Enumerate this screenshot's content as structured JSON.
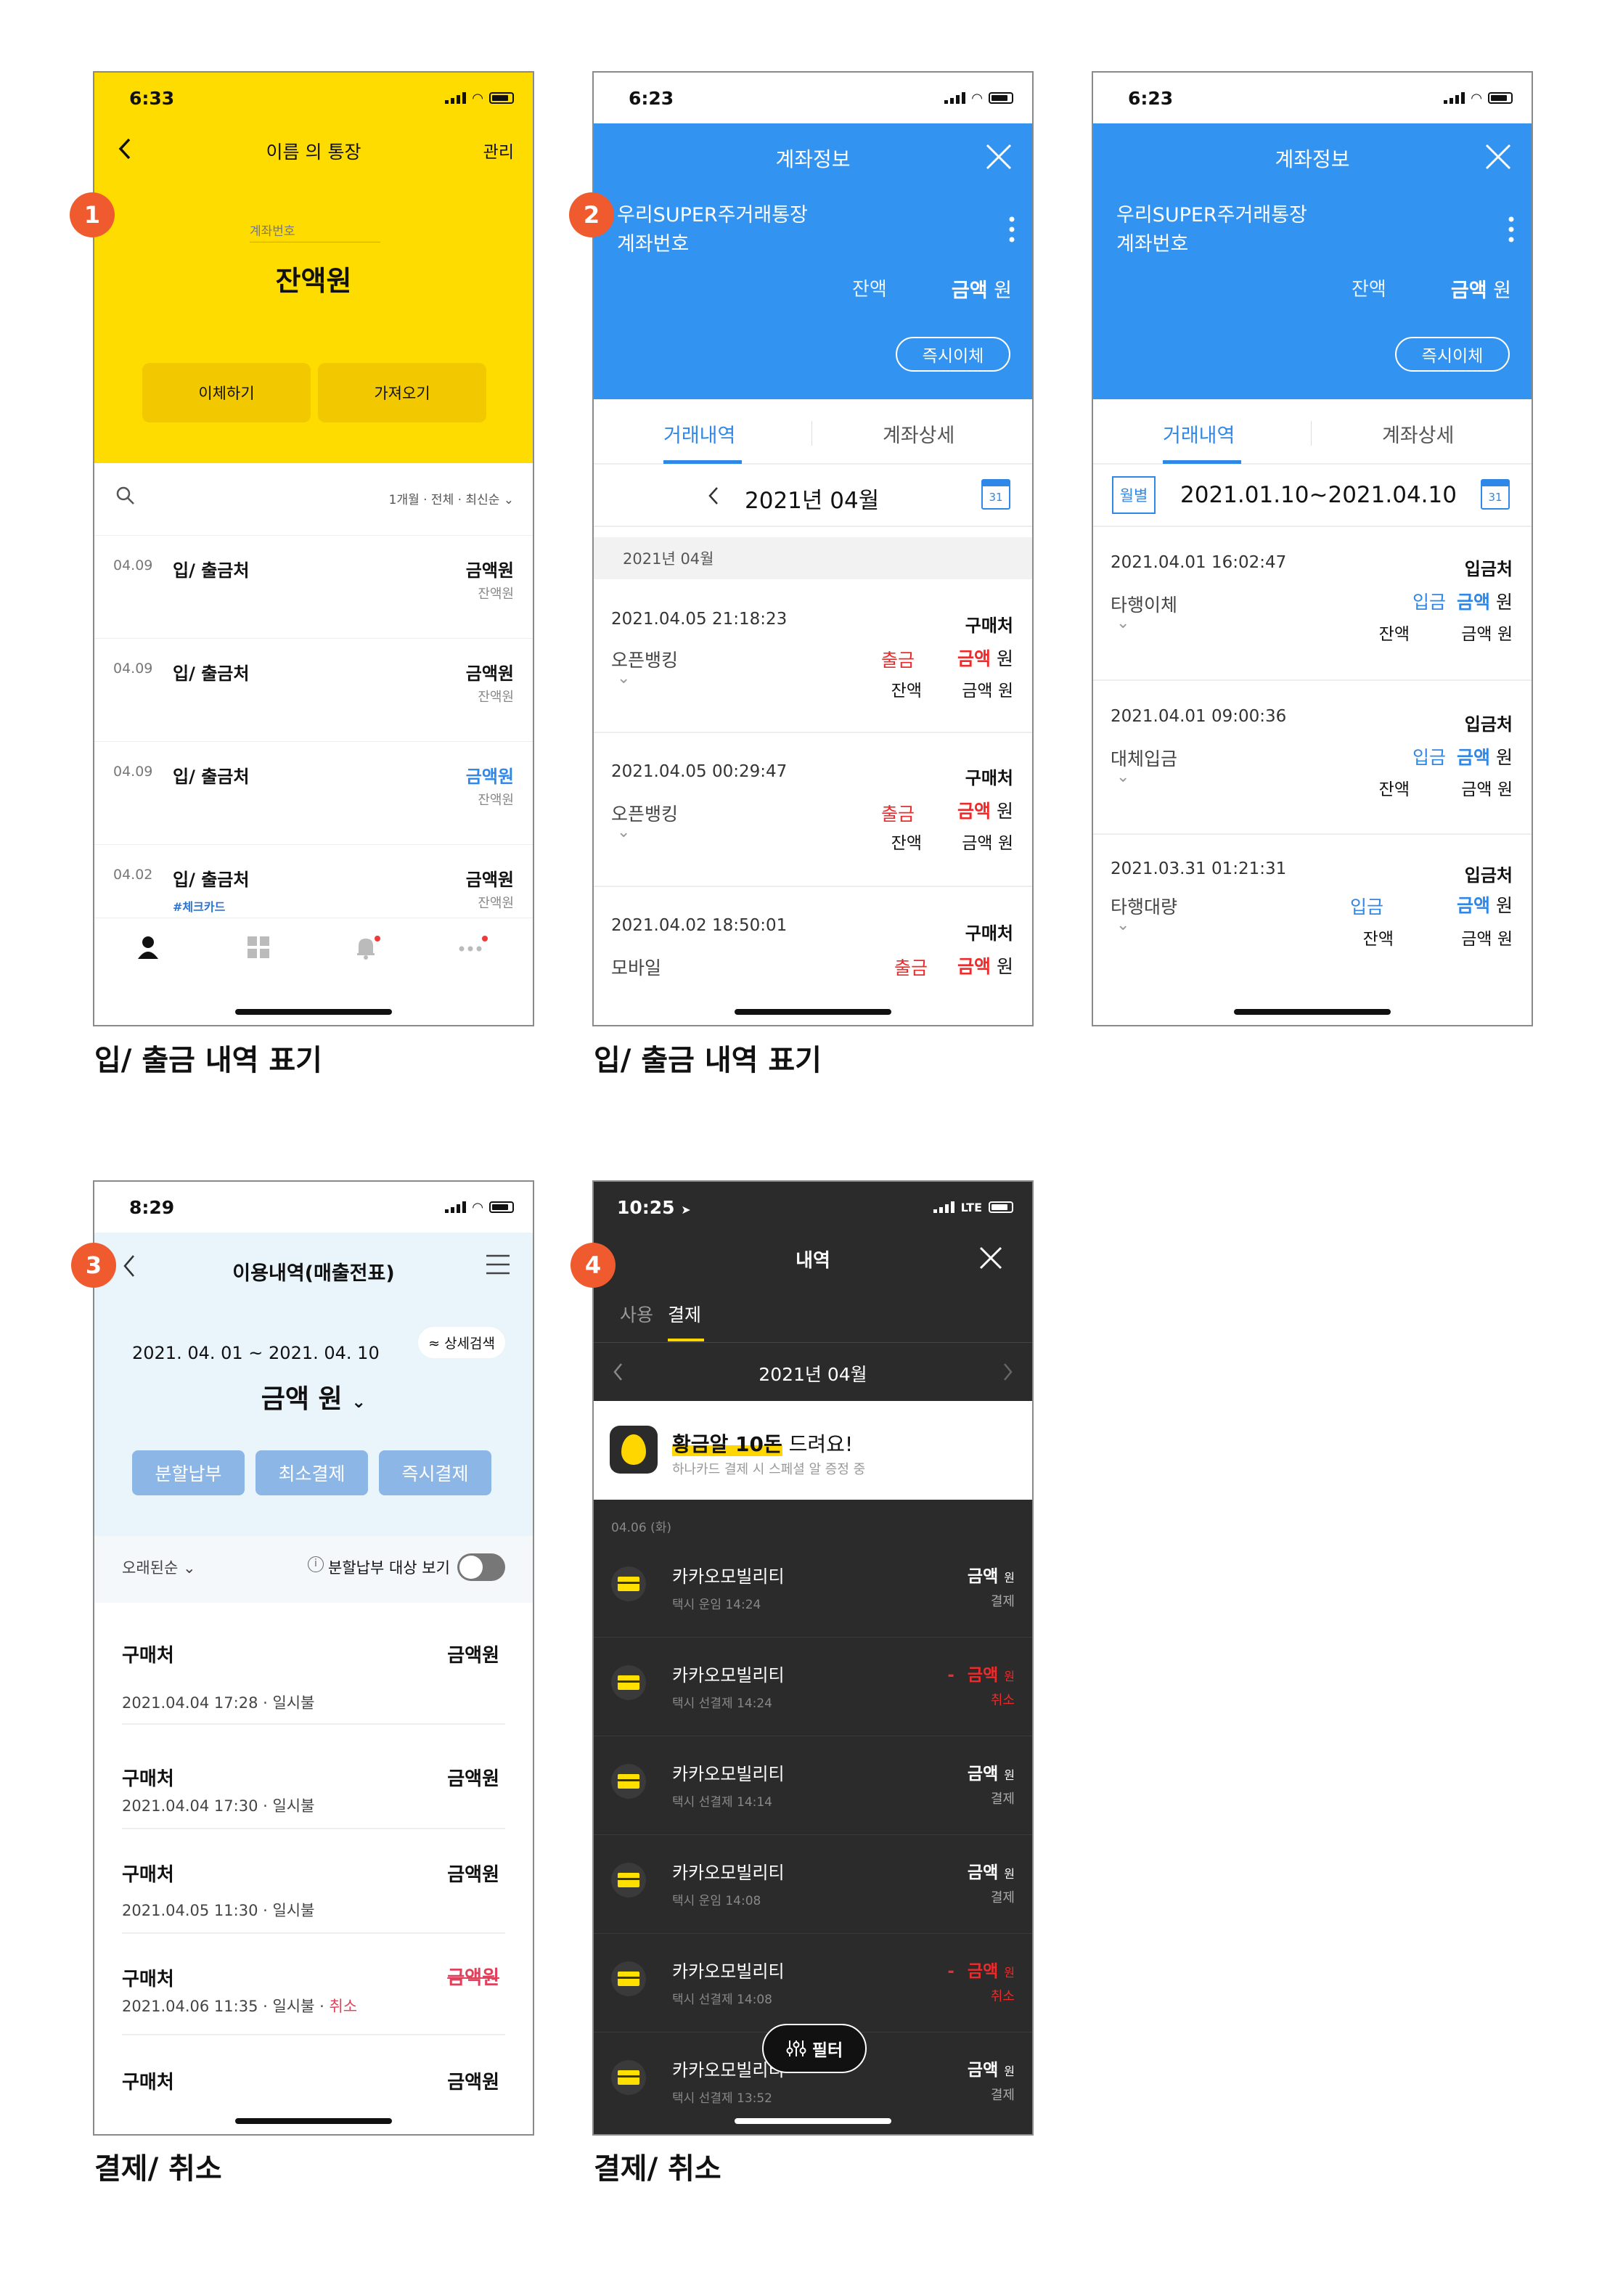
{
  "captions": {
    "c1": "입/ 출금 내역 표기",
    "c2": "입/ 출금 내역 표기",
    "c3": "결제/ 취소",
    "c4": "결제/ 취소"
  },
  "badges": [
    "1",
    "2",
    "3",
    "4"
  ],
  "colors": {
    "yellow": "#ffdc00",
    "blue": "#3293f0",
    "badge": "#ef5b2f",
    "dark": "#2b2b2b",
    "red": "#ef2a2a",
    "accent_blue": "#2f88e8"
  },
  "phone1": {
    "time": "6:33",
    "title": "이름 의 통장",
    "manage": "관리",
    "account_label": "계좌번호",
    "balance": "잔액원",
    "transfer": "이체하기",
    "fetch": "가져오기",
    "filter": "1개월 · 전체 · 최신순",
    "rows": [
      {
        "date": "04.09",
        "name": "입/ 출금처",
        "amount": "금액원",
        "balance": "잔액원",
        "tag": ""
      },
      {
        "date": "04.09",
        "name": "입/ 출금처",
        "amount": "금액원",
        "balance": "잔액원",
        "tag": ""
      },
      {
        "date": "04.09",
        "name": "입/ 출금처",
        "amount": "금액원",
        "balance": "잔액원",
        "tag": ""
      },
      {
        "date": "04.02",
        "name": "입/ 출금처",
        "amount": "금액원",
        "balance": "잔액원",
        "tag": "#체크카드"
      }
    ],
    "nav_icons": [
      "person-icon",
      "grid-icon",
      "bell-icon",
      "more-icon"
    ]
  },
  "phone2": {
    "time": "6:23",
    "title": "계좌정보",
    "account_name": "우리SUPER주거래통장",
    "account_num": "계좌번호",
    "bal_label": "잔액",
    "bal_value": "금액",
    "won": "원",
    "instant": "즉시이체",
    "tab_history": "거래내역",
    "tab_detail": "계좌상세",
    "month": "2021년  04월",
    "cal_day": "31",
    "section": "2021년 04월",
    "rows": [
      {
        "datetime": "2021.04.05 21:18:23",
        "who": "구매처",
        "desc": "오픈뱅킹",
        "type": "출금",
        "amount": "금액",
        "won": "원",
        "bal_label": "잔액",
        "bal": "금액 원"
      },
      {
        "datetime": "2021.04.05 00:29:47",
        "who": "구매처",
        "desc": "오픈뱅킹",
        "type": "출금",
        "amount": "금액",
        "won": "원",
        "bal_label": "잔액",
        "bal": "금액 원"
      },
      {
        "datetime": "2021.04.02 18:50:01",
        "who": "구매처",
        "desc": "모바일",
        "type": "출금",
        "amount": "금액",
        "won": "원"
      }
    ]
  },
  "phone3": {
    "time": "6:23",
    "title": "계좌정보",
    "account_name": "우리SUPER주거래통장",
    "account_num": "계좌번호",
    "bal_label": "잔액",
    "bal_value": "금액",
    "won": "원",
    "instant": "즉시이체",
    "tab_history": "거래내역",
    "tab_detail": "계좌상세",
    "monthly": "월별",
    "range": "2021.01.10~2021.04.10",
    "cal_day": "31",
    "rows": [
      {
        "datetime": "2021.04.01  16:02:47",
        "who": "입금처",
        "desc": "타행이체",
        "type": "입금",
        "amount": "금액",
        "won": "원",
        "bal_label": "잔액",
        "bal": "금액 원"
      },
      {
        "datetime": "2021.04.01  09:00:36",
        "who": "입금처",
        "desc": "대체입금",
        "type": "입금",
        "amount": "금액",
        "won": "원",
        "bal_label": "잔액",
        "bal": "금액 원"
      },
      {
        "datetime": "2021.03.31  01:21:31",
        "who": "입금처",
        "desc": "타행대량",
        "type": "입금",
        "amount": "금액",
        "won": "원",
        "bal_label": "잔액",
        "bal": "금액 원"
      }
    ]
  },
  "phone4": {
    "time": "8:29",
    "title": "이용내역(매출전표)",
    "period": "2021. 04. 01 ~ 2021. 04. 10",
    "detail_search": "상세검색",
    "total": "금액  원",
    "btn_installment": "분할납부",
    "btn_min": "최소결제",
    "btn_instant": "즉시결제",
    "sort": "오래된순",
    "toggle_label": "분할납부 대상 보기",
    "rows": [
      {
        "name": "구매처",
        "amount": "금액원",
        "meta": "2021.04.04 17:28 · 일시불",
        "cancel": ""
      },
      {
        "name": "구매처",
        "amount": "금액원",
        "meta": "2021.04.04 17:30 · 일시불",
        "cancel": ""
      },
      {
        "name": "구매처",
        "amount": "금액원",
        "meta": "2021.04.05 11:30 · 일시불",
        "cancel": ""
      },
      {
        "name": "구매처",
        "amount": "금액원",
        "meta": "2021.04.06 11:35 · 일시불 ·",
        "cancel": "취소"
      },
      {
        "name": "구매처",
        "amount": "금액원",
        "meta": "",
        "cancel": ""
      }
    ]
  },
  "phone5": {
    "time": "10:25",
    "network": "LTE",
    "title": "내역",
    "tab_use": "사용",
    "tab_pay": "결제",
    "month": "2021년 04월",
    "banner_title": "황금알 10돈 드려요!",
    "banner_title_em": "황금알 10돈",
    "banner_title_rest": " 드려요!",
    "banner_sub": "하나카드 결제 시 스페셜 알 증정 중",
    "date_head": "04.06 (화)",
    "filter": "필터",
    "rows": [
      {
        "name": "카카오모빌리티",
        "sub": "택시 운임 14:24",
        "amount": "금액",
        "won": "원",
        "status": "결제",
        "minus": ""
      },
      {
        "name": "카카오모빌리티",
        "sub": "택시 선결제 14:24",
        "amount": "금액",
        "won": "원",
        "status": "취소",
        "minus": "-"
      },
      {
        "name": "카카오모빌리티",
        "sub": "택시 선결제 14:14",
        "amount": "금액",
        "won": "원",
        "status": "결제",
        "minus": ""
      },
      {
        "name": "카카오모빌리티",
        "sub": "택시 운임 14:08",
        "amount": "금액",
        "won": "원",
        "status": "결제",
        "minus": ""
      },
      {
        "name": "카카오모빌리티",
        "sub": "택시 선결제 14:08",
        "amount": "금액",
        "won": "원",
        "status": "취소",
        "minus": "-"
      },
      {
        "name": "카카오모빌리티",
        "sub": "택시 선결제 13:52",
        "amount": "금액",
        "won": "원",
        "status": "결제",
        "minus": ""
      }
    ]
  }
}
